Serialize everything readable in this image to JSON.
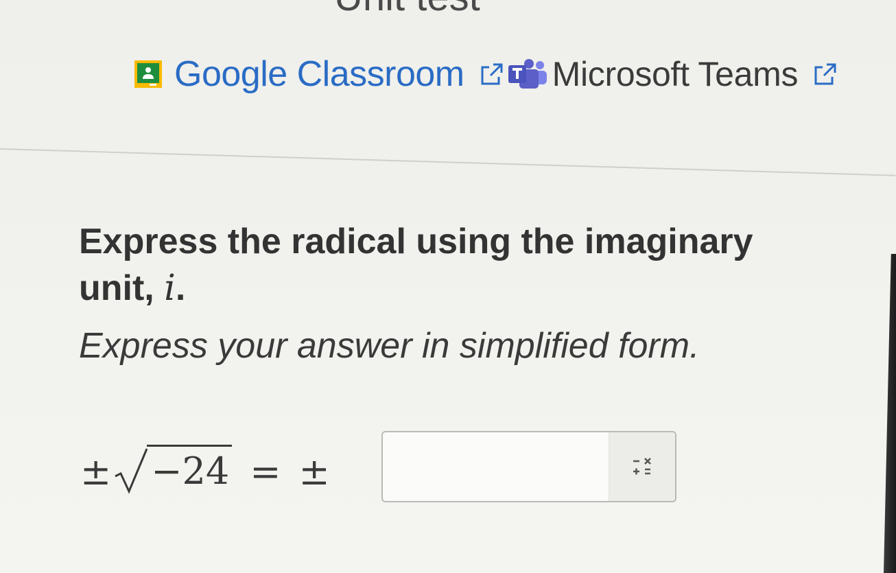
{
  "header": {
    "title": "Unit test"
  },
  "share": {
    "google_classroom_label": "Google Classroom",
    "microsoft_teams_label": "Microsoft Teams"
  },
  "question": {
    "prompt_text": "Express the radical using the imaginary unit, ",
    "prompt_variable": "i",
    "prompt_end": ".",
    "instruction": "Express your answer in simplified form.",
    "equation": {
      "plus_minus_left": "±",
      "radicand": "−24",
      "equals": "=",
      "plus_minus_right": "±"
    }
  },
  "answer": {
    "value": ""
  },
  "colors": {
    "link_blue": "#2a6cc5",
    "classroom_green": "#1e8e3e",
    "classroom_yellow": "#f9ba00",
    "teams_purple": "#5b5fc7"
  },
  "icons": {
    "classroom": "google-classroom-icon",
    "external": "external-link-icon",
    "teams": "microsoft-teams-icon",
    "math_keyboard": "math-keypad-icon"
  }
}
